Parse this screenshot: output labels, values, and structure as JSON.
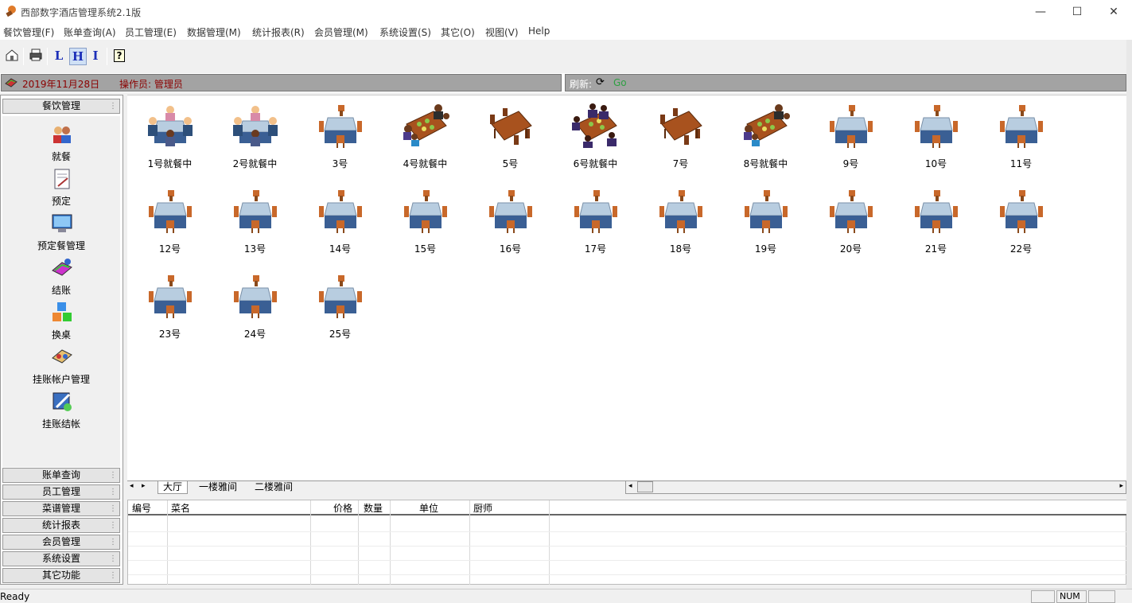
{
  "window": {
    "title": "西部数字酒店管理系统2.1版",
    "minimize": "—",
    "maximize": "☐",
    "close": "✕"
  },
  "menu": [
    "餐饮管理(F)",
    "账单查询(A)",
    "员工管理(E)",
    "数据管理(M)",
    "统计报表(R)",
    "会员管理(M)",
    "系统设置(S)",
    "其它(O)",
    "视图(V)",
    "Help"
  ],
  "toolbar": {
    "L": "L",
    "H": "H",
    "I": "I",
    "help": "?"
  },
  "info": {
    "date": "2019年11月28日",
    "operator": "操作员: 管理员",
    "refresh_label": "刷新:",
    "refresh_value": "Go"
  },
  "sidebar": {
    "active_group": "餐饮管理",
    "items": [
      "就餐",
      "预定",
      "预定餐管理",
      "结账",
      "换桌",
      "挂账帐户管理",
      "挂账结帐"
    ],
    "groups": [
      "账单查询",
      "员工管理",
      "菜谱管理",
      "统计报表",
      "会员管理",
      "系统设置",
      "其它功能"
    ]
  },
  "tables": [
    {
      "name": "1号就餐中",
      "state": "occupied-a"
    },
    {
      "name": "2号就餐中",
      "state": "occupied-a"
    },
    {
      "name": "3号",
      "state": "empty"
    },
    {
      "name": "4号就餐中",
      "state": "occupied-b"
    },
    {
      "name": "5号",
      "state": "long-empty"
    },
    {
      "name": "6号就餐中",
      "state": "occupied-c"
    },
    {
      "name": "7号",
      "state": "long-empty"
    },
    {
      "name": "8号就餐中",
      "state": "occupied-b"
    },
    {
      "name": "9号",
      "state": "empty"
    },
    {
      "name": "10号",
      "state": "empty"
    },
    {
      "name": "11号",
      "state": "empty"
    },
    {
      "name": "12号",
      "state": "empty"
    },
    {
      "name": "13号",
      "state": "empty"
    },
    {
      "name": "14号",
      "state": "empty"
    },
    {
      "name": "15号",
      "state": "empty"
    },
    {
      "name": "16号",
      "state": "empty"
    },
    {
      "name": "17号",
      "state": "empty"
    },
    {
      "name": "18号",
      "state": "empty"
    },
    {
      "name": "19号",
      "state": "empty"
    },
    {
      "name": "20号",
      "state": "empty"
    },
    {
      "name": "21号",
      "state": "empty"
    },
    {
      "name": "22号",
      "state": "empty"
    },
    {
      "name": "23号",
      "state": "empty"
    },
    {
      "name": "24号",
      "state": "empty"
    },
    {
      "name": "25号",
      "state": "empty"
    }
  ],
  "tabs": [
    "大厅",
    "一楼雅间",
    "二楼雅间"
  ],
  "grid": {
    "columns": [
      "编号",
      "菜名",
      "价格",
      "数量",
      "单位",
      "厨师"
    ]
  },
  "status": {
    "ready": "Ready",
    "num": "NUM"
  }
}
